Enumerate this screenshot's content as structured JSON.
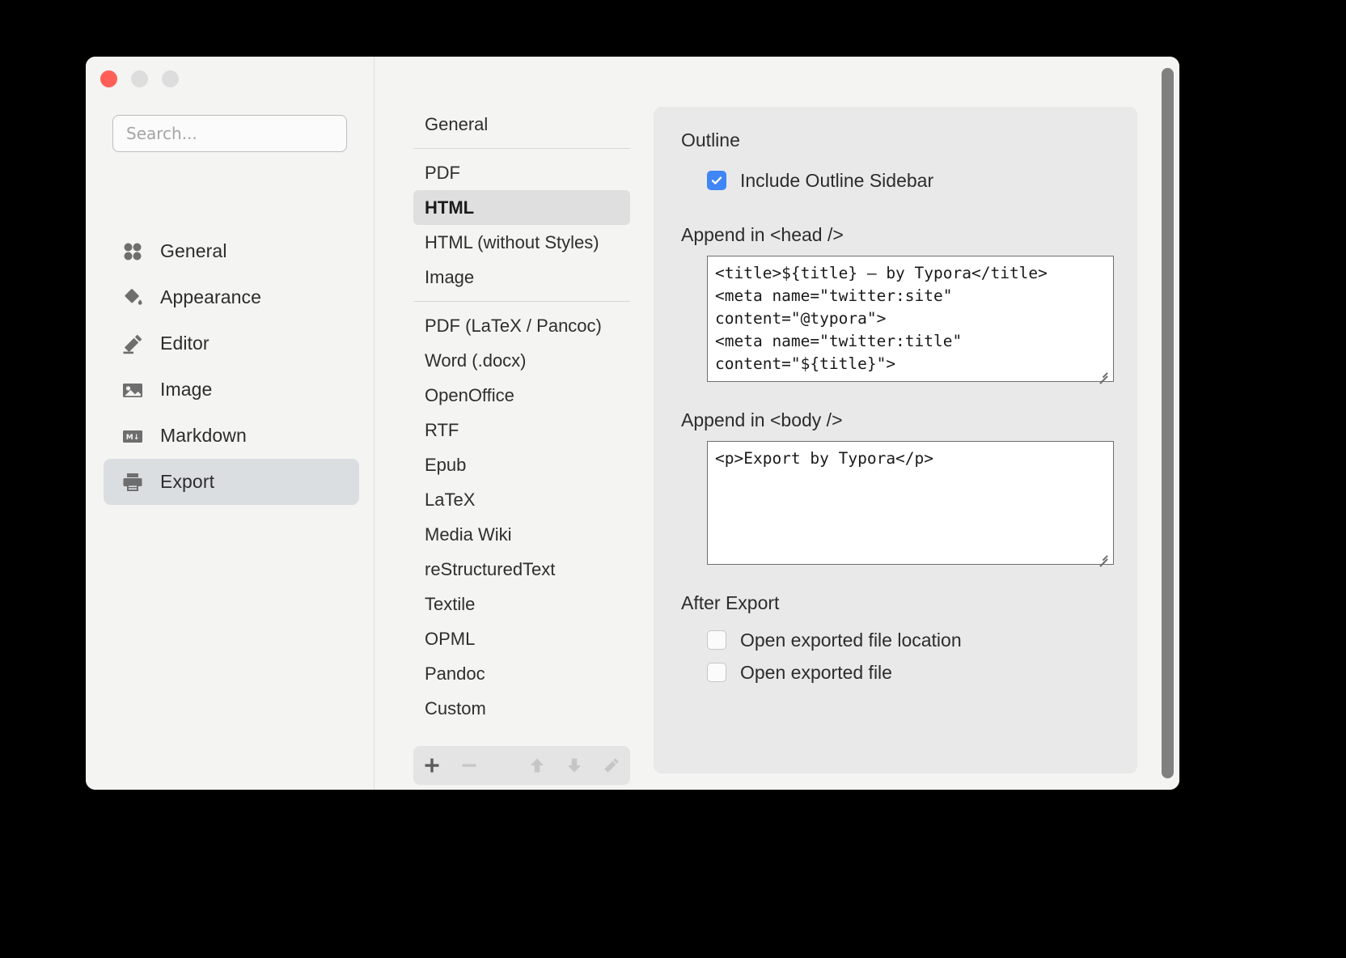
{
  "window": {
    "traffic_lights": [
      "close",
      "minimize",
      "maximize"
    ],
    "colors": {
      "close": "#ff5f57",
      "minimize": "#dddddd",
      "maximize": "#dddddd",
      "accent_checkbox": "#3f86f6",
      "window_bg": "#f4f4f3",
      "card_bg": "#e9e9e9",
      "selected_nav_bg": "#dadee1",
      "selected_fmt_bg": "#dfdfdf",
      "scrollbar_thumb": "#808080"
    }
  },
  "search": {
    "value": "",
    "placeholder": "Search..."
  },
  "sidebar": {
    "items": [
      {
        "label": "General",
        "icon": "four-dots-icon",
        "selected": false
      },
      {
        "label": "Appearance",
        "icon": "paint-bucket-icon",
        "selected": false
      },
      {
        "label": "Editor",
        "icon": "pencil-icon",
        "selected": false
      },
      {
        "label": "Image",
        "icon": "picture-icon",
        "selected": false
      },
      {
        "label": "Markdown",
        "icon": "markdown-icon",
        "selected": false
      },
      {
        "label": "Export",
        "icon": "printer-icon",
        "selected": true
      }
    ]
  },
  "format_list": {
    "groups": [
      {
        "items": [
          {
            "label": "General",
            "selected": false
          }
        ]
      },
      {
        "items": [
          {
            "label": "PDF",
            "selected": false
          },
          {
            "label": "HTML",
            "selected": true
          },
          {
            "label": "HTML (without Styles)",
            "selected": false
          },
          {
            "label": "Image",
            "selected": false
          }
        ]
      },
      {
        "items": [
          {
            "label": "PDF (LaTeX / Pancoc)",
            "selected": false
          },
          {
            "label": "Word (.docx)",
            "selected": false
          },
          {
            "label": "OpenOffice",
            "selected": false
          },
          {
            "label": "RTF",
            "selected": false
          },
          {
            "label": "Epub",
            "selected": false
          },
          {
            "label": "LaTeX",
            "selected": false
          },
          {
            "label": "Media Wiki",
            "selected": false
          },
          {
            "label": "reStructuredText",
            "selected": false
          },
          {
            "label": "Textile",
            "selected": false
          },
          {
            "label": "OPML",
            "selected": false
          },
          {
            "label": "Pandoc",
            "selected": false
          },
          {
            "label": "Custom",
            "selected": false
          }
        ]
      }
    ],
    "toolbar": {
      "add": "+",
      "remove": "−",
      "move_up": "move-up",
      "move_down": "move-down",
      "edit": "edit"
    }
  },
  "panel": {
    "outline": {
      "title": "Outline",
      "include_outline_sidebar": {
        "label": "Include Outline Sidebar",
        "checked": true
      }
    },
    "append_head": {
      "label": "Append in <head />",
      "value": "<title>${title} – by Typora</title>\n<meta name=\"twitter:site\"\ncontent=\"@typora\">\n<meta name=\"twitter:title\"\ncontent=\"${title}\">"
    },
    "append_body": {
      "label": "Append in <body />",
      "value": "<p>Export by Typora</p>"
    },
    "after_export": {
      "title": "After Export",
      "options": [
        {
          "label": "Open exported file location",
          "checked": false
        },
        {
          "label": "Open exported file",
          "checked": false
        }
      ]
    }
  }
}
